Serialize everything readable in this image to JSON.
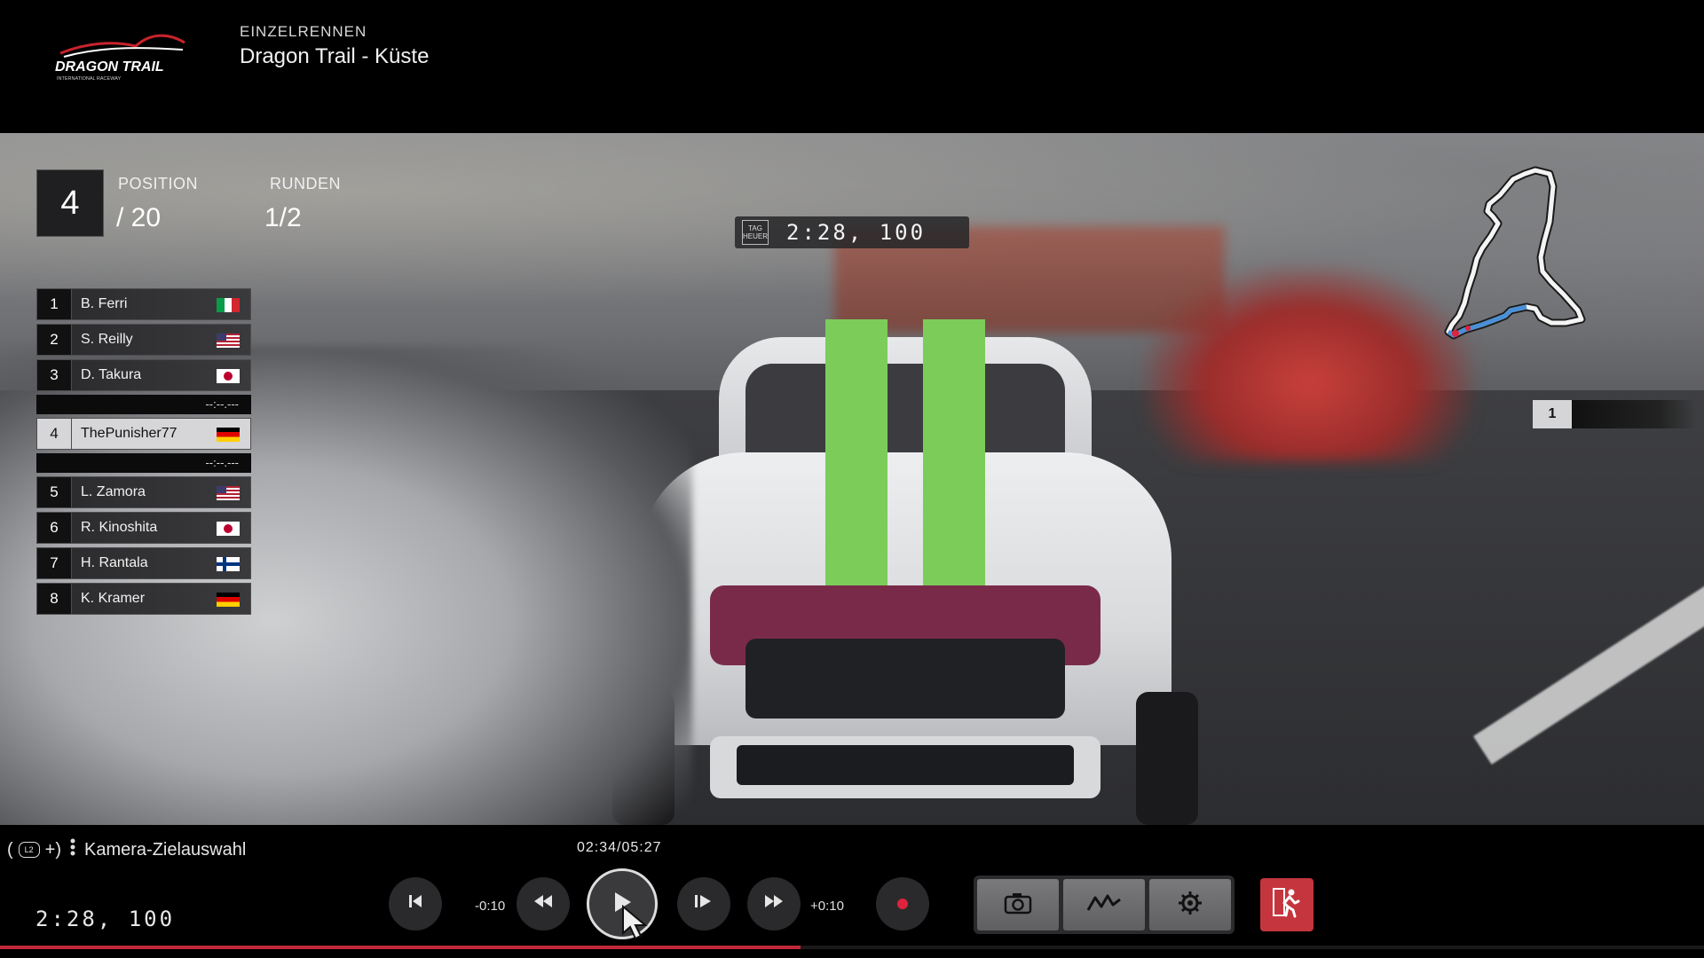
{
  "header": {
    "logo_text": "DRAGON TRAIL",
    "logo_sub": "INTERNATIONAL RACEWAY",
    "event_type": "EINZELRENNEN",
    "track_name": "Dragon Trail - Küste"
  },
  "hud": {
    "position_value": "4",
    "position_label": "POSITION",
    "position_total": "/ 20",
    "laps_label": "RUNDEN",
    "laps_value": "1/2",
    "timer_brand": "TAG HEUER",
    "lap_time": "2:28, 100",
    "minimap_rank": "1"
  },
  "leaderboard": {
    "rows": [
      {
        "pos": "1",
        "name": "B. Ferri",
        "flag": "italy-flag"
      },
      {
        "pos": "2",
        "name": "S. Reilly",
        "flag": "usa-flag"
      },
      {
        "pos": "3",
        "name": "D. Takura",
        "flag": "japan-flag"
      },
      {
        "gap": "--:--.---"
      },
      {
        "pos": "4",
        "name": "ThePunisher77",
        "flag": "germany-flag",
        "highlight": true
      },
      {
        "gap": "--:--.---"
      },
      {
        "pos": "5",
        "name": "L. Zamora",
        "flag": "usa-flag"
      },
      {
        "pos": "6",
        "name": "R. Kinoshita",
        "flag": "japan-flag"
      },
      {
        "pos": "7",
        "name": "H. Rantala",
        "flag": "finland-flag"
      },
      {
        "pos": "8",
        "name": "K. Kramer",
        "flag": "germany-flag"
      }
    ]
  },
  "replay": {
    "hint_open": "(",
    "hint_l2": "L2",
    "hint_plus": "+)",
    "hint_text": "Kamera-Zielauswahl",
    "playback_time": "02:34/05:27",
    "step_back_label": "-0:10",
    "step_forward_label": "+0:10",
    "total_time": "2:28, 100",
    "progress_fraction": 0.47,
    "icons": [
      "skip-to-start-icon",
      "rewind-icon",
      "play-icon",
      "frame-advance-icon",
      "fast-forward-icon",
      "record-icon",
      "camera-icon",
      "telemetry-icon",
      "settings-gear-icon",
      "exit-icon"
    ]
  },
  "colors": {
    "accent_red": "#c4353e",
    "progress_red": "#c1273a",
    "highlight_row": "#d6d6d8"
  }
}
